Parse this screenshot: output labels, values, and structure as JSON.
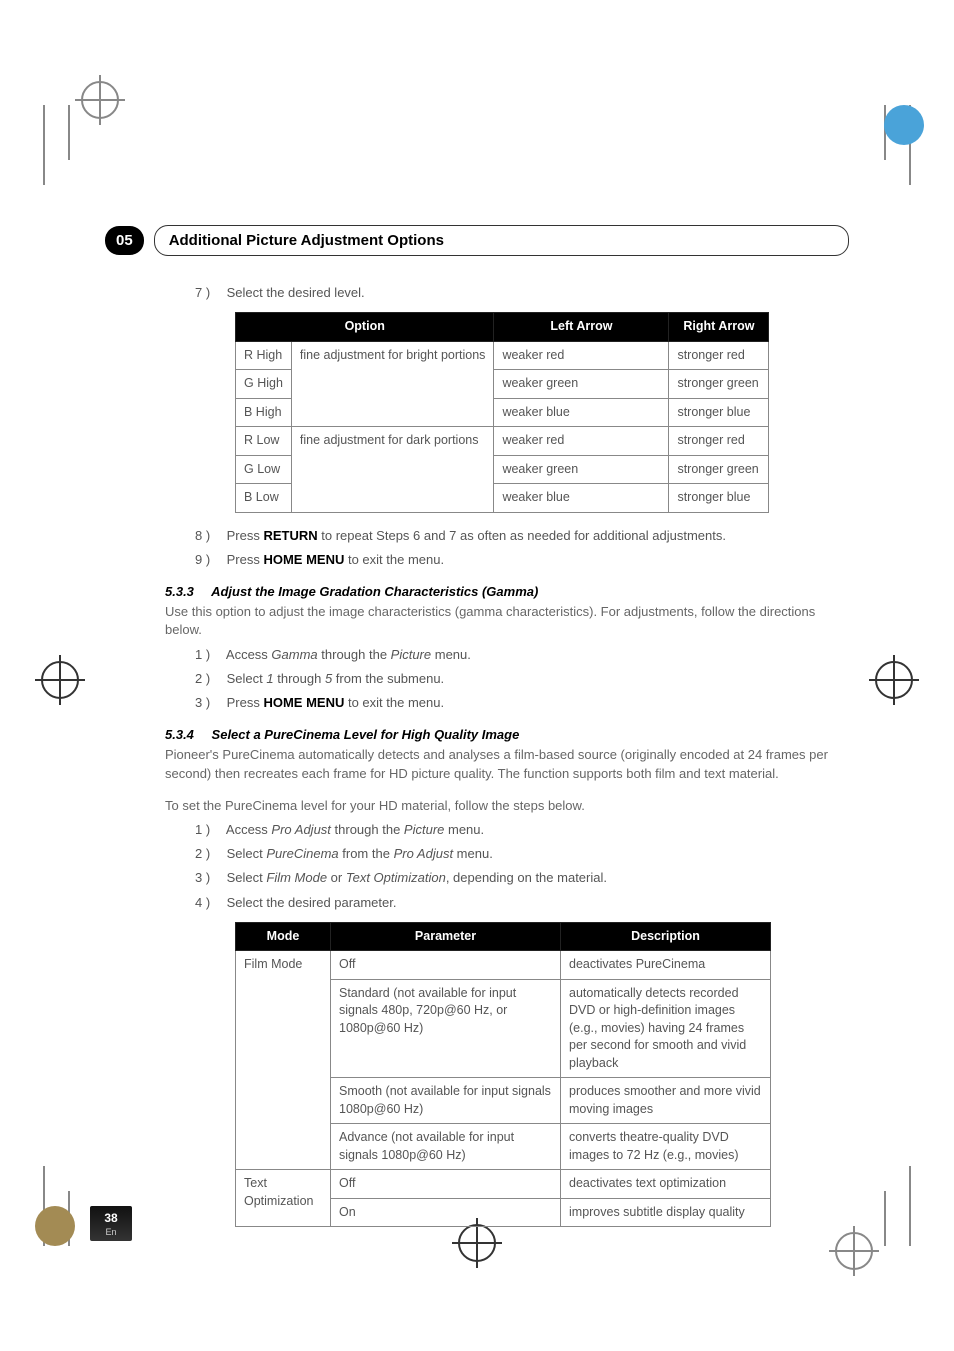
{
  "chapter": {
    "number": "05",
    "title": "Additional Picture Adjustment Options"
  },
  "step7": {
    "num": "7 )",
    "text": "Select the desired level."
  },
  "table1": {
    "headers": [
      "Option",
      "",
      "Left Arrow",
      "Right Arrow"
    ],
    "rows": [
      {
        "c1": "R High",
        "c2": "fine adjustment for bright portions",
        "c3": "weaker red",
        "c4": "stronger red"
      },
      {
        "c1": "G High",
        "c2": "",
        "c3": "weaker green",
        "c4": "stronger green"
      },
      {
        "c1": "B High",
        "c2": "",
        "c3": "weaker blue",
        "c4": "stronger blue"
      },
      {
        "c1": "R Low",
        "c2": "fine adjustment for dark portions",
        "c3": "weaker red",
        "c4": "stronger red"
      },
      {
        "c1": "G Low",
        "c2": "",
        "c3": "weaker green",
        "c4": "stronger green"
      },
      {
        "c1": "B Low",
        "c2": "",
        "c3": "weaker blue",
        "c4": "stronger blue"
      }
    ]
  },
  "step8": {
    "num": "8 )",
    "pre": "Press ",
    "bold": "RETURN",
    "post": " to repeat Steps 6 and 7 as often as needed for additional adjustments."
  },
  "step9": {
    "num": "9 )",
    "pre": "Press ",
    "bold": "HOME MENU",
    "post": " to exit the menu."
  },
  "s533": {
    "num": "5.3.3",
    "title": "Adjust the Image Gradation Characteristics (Gamma)",
    "intro": "Use this option to adjust the image characteristics (gamma characteristics). For adjustments, follow the directions below.",
    "s1": {
      "num": "1 )",
      "a": "Access ",
      "i1": "Gamma",
      "b": " through the ",
      "i2": "Picture",
      "c": " menu."
    },
    "s2": {
      "num": "2 )",
      "a": "Select ",
      "i1": "1",
      "b": " through ",
      "i2": "5",
      "c": " from the submenu."
    },
    "s3": {
      "num": "3 )",
      "pre": "Press ",
      "bold": "HOME MENU",
      "post": " to exit the menu."
    }
  },
  "s534": {
    "num": "5.3.4",
    "title": "Select a PureCinema Level for High Quality Image",
    "p1": "Pioneer's PureCinema automatically detects and analyses a film-based source (originally encoded at 24 frames per second) then recreates each frame for HD picture quality. The function supports both film and text material.",
    "p2": "To set the PureCinema level for your HD material, follow the steps below.",
    "s1": {
      "num": "1 )",
      "a": "Access ",
      "i1": "Pro Adjust",
      "b": " through the ",
      "i2": "Picture",
      "c": " menu."
    },
    "s2": {
      "num": "2 )",
      "a": "Select ",
      "i1": "PureCinema",
      "b": " from the ",
      "i2": "Pro Adjust",
      "c": " menu."
    },
    "s3": {
      "num": "3 )",
      "a": "Select ",
      "i1": "Film Mode",
      "b": " or ",
      "i2": "Text Optimization",
      "c": ", depending on the material."
    },
    "s4": {
      "num": "4 )",
      "text": "Select the desired parameter."
    }
  },
  "table2": {
    "headers": [
      "Mode",
      "Parameter",
      "Description"
    ],
    "rows": [
      {
        "c1": "Film Mode",
        "c2": "Off",
        "c3": "deactivates PureCinema"
      },
      {
        "c1": "",
        "c2": "Standard (not available for input signals 480p, 720p@60 Hz, or 1080p@60 Hz)",
        "c3": "automatically detects recorded DVD or high-definition images (e.g., movies) having 24 frames per second for smooth and vivid playback"
      },
      {
        "c1": "",
        "c2": "Smooth (not available for input signals 1080p@60 Hz)",
        "c3": "produces smoother and more vivid moving images"
      },
      {
        "c1": "",
        "c2": "Advance (not available for input signals 1080p@60 Hz)",
        "c3": "converts theatre-quality DVD images to 72 Hz (e.g., movies)"
      },
      {
        "c1": "Text Optimization",
        "c2": "Off",
        "c3": "deactivates text optimization"
      },
      {
        "c1": "",
        "c2": "On",
        "c3": "improves subtitle display quality"
      }
    ]
  },
  "pageFooter": {
    "num": "38",
    "lang": "En"
  }
}
